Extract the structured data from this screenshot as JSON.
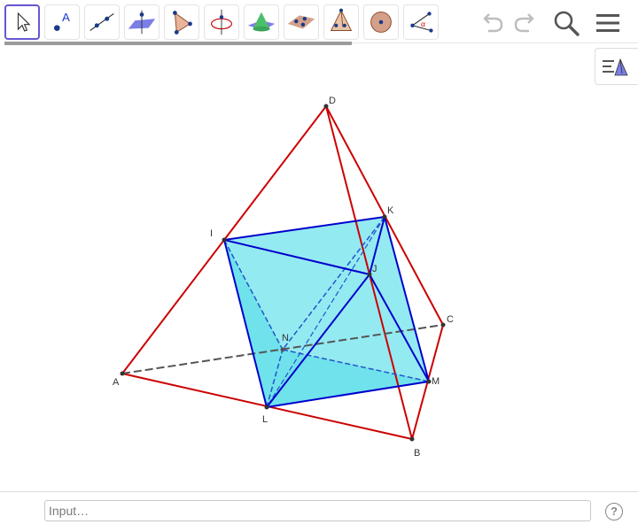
{
  "toolbar": {
    "tools": [
      {
        "name": "move-tool-icon"
      },
      {
        "name": "point-tool-icon",
        "label": "A"
      },
      {
        "name": "line-tool-icon"
      },
      {
        "name": "plane-tool-icon"
      },
      {
        "name": "polygon-tool-icon"
      },
      {
        "name": "rotate-around-line-icon"
      },
      {
        "name": "cone-tool-icon"
      },
      {
        "name": "net-tool-icon"
      },
      {
        "name": "pyramid-tool-icon"
      },
      {
        "name": "sphere-tool-icon"
      },
      {
        "name": "angle-tool-icon",
        "label": "α"
      }
    ],
    "right": [
      "undo-icon",
      "redo-icon",
      "search-icon",
      "menu-icon"
    ]
  },
  "points": {
    "A": "A",
    "B": "B",
    "C": "C",
    "D": "D",
    "I": "I",
    "J": "J",
    "K": "K",
    "L": "L",
    "M": "M",
    "N": "N"
  },
  "colors": {
    "tetrahedron_edge": "#cc0000",
    "octahedron_edge": "#0000cc",
    "octahedron_fill": "#00ccdd",
    "selected_tool": "#6557d2"
  },
  "input_bar": {
    "placeholder": "Input…",
    "help_label": "?"
  }
}
